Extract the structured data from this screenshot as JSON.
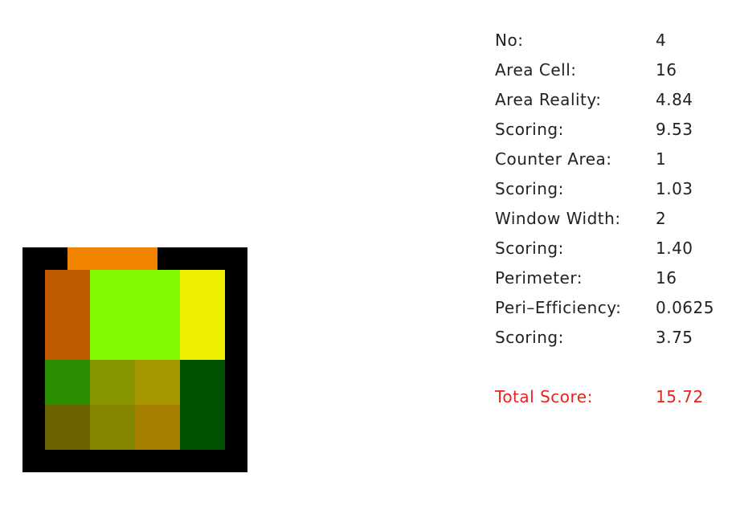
{
  "grid": {
    "cols": 5,
    "rows": 5,
    "cells": [
      [
        "#000000",
        "#000000",
        "#000000",
        "#000000",
        "#000000"
      ],
      [
        "#000000",
        "#000000",
        "#000000",
        "#000000",
        "#000000"
      ],
      [
        "#000000",
        "#000000",
        "#000000",
        "#000000",
        "#000000"
      ],
      [
        "#000000",
        "#000000",
        "#000000",
        "#000000",
        "#000000"
      ],
      [
        "#000000",
        "#000000",
        "#000000",
        "#000000",
        "#000000"
      ]
    ],
    "overlay": [
      {
        "r": 0,
        "c": 1,
        "w": 2,
        "h": 0.5,
        "color": "#f28300"
      },
      {
        "r": 0.5,
        "c": 0.5,
        "w": 1,
        "h": 2,
        "color": "#bf5a00"
      },
      {
        "r": 0.5,
        "c": 1.5,
        "w": 2,
        "h": 2,
        "color": "#82fa00"
      },
      {
        "r": 0.5,
        "c": 3.5,
        "w": 1,
        "h": 2,
        "color": "#eeee00"
      },
      {
        "r": 2.5,
        "c": 0.5,
        "w": 1,
        "h": 1,
        "color": "#2a8f00"
      },
      {
        "r": 2.5,
        "c": 1.5,
        "w": 1,
        "h": 1,
        "color": "#879600"
      },
      {
        "r": 2.5,
        "c": 2.5,
        "w": 1,
        "h": 1,
        "color": "#a69600"
      },
      {
        "r": 2.5,
        "c": 3.5,
        "w": 1,
        "h": 2,
        "color": "#005200"
      },
      {
        "r": 3.5,
        "c": 0.5,
        "w": 1,
        "h": 1,
        "color": "#6b6200"
      },
      {
        "r": 3.5,
        "c": 1.5,
        "w": 1,
        "h": 1,
        "color": "#858600"
      },
      {
        "r": 3.5,
        "c": 2.5,
        "w": 1,
        "h": 1,
        "color": "#a57f00"
      }
    ]
  },
  "stats": [
    {
      "label": "No:",
      "value": "4"
    },
    {
      "label": "Area Cell:",
      "value": "16"
    },
    {
      "label": "Area Reality:",
      "value": "4.84"
    },
    {
      "label": "Scoring:",
      "value": "9.53"
    },
    {
      "label": "Counter Area:",
      "value": "1"
    },
    {
      "label": "Scoring:",
      "value": "1.03"
    },
    {
      "label": "Window Width:",
      "value": "2"
    },
    {
      "label": "Scoring:",
      "value": "1.40"
    },
    {
      "label": "Perimeter:",
      "value": "16"
    },
    {
      "label": "Peri–Efficiency:",
      "value": "0.0625"
    },
    {
      "label": "Scoring:",
      "value": "3.75"
    }
  ],
  "total": {
    "label": "Total Score:",
    "value": "15.72"
  },
  "colors": {
    "text": "#222222",
    "total": "#e8231e",
    "border": "#000000"
  }
}
